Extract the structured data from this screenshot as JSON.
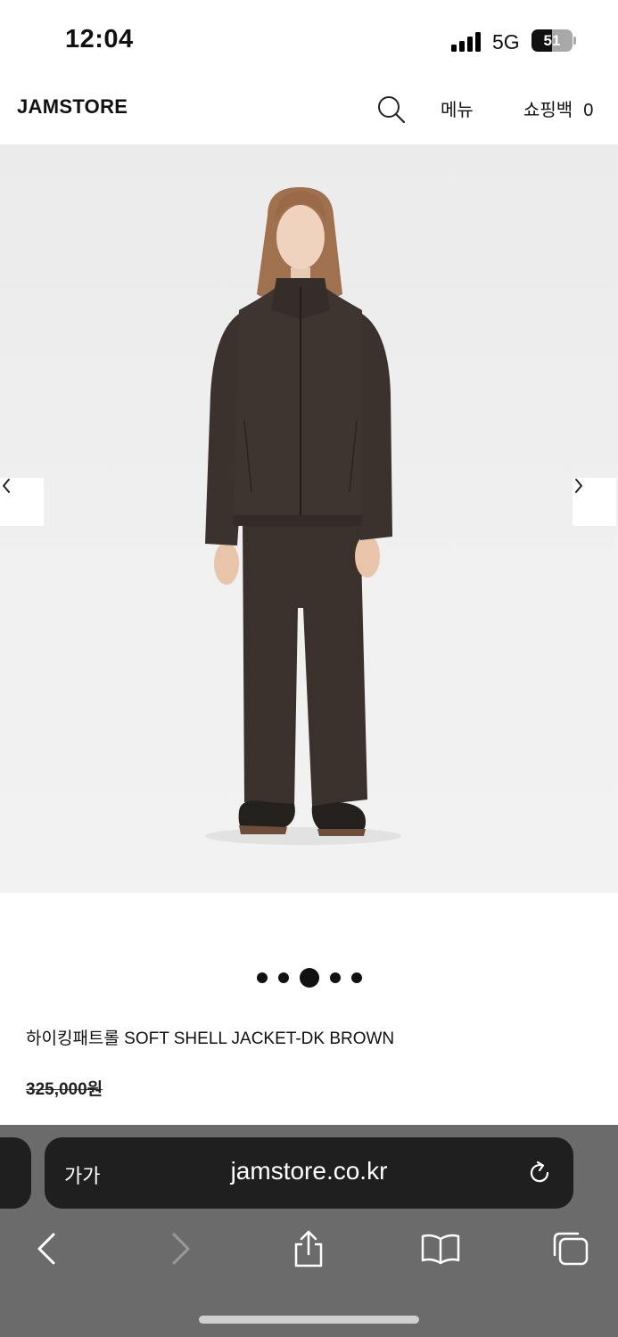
{
  "status_bar": {
    "time": "12:04",
    "network": "5G",
    "battery": "51",
    "battery_level": 0.51,
    "icons": [
      "signal-icon",
      "battery-icon"
    ]
  },
  "header": {
    "logo": "JAMSTORE",
    "search_icon": "search-icon",
    "menu_label": "메뉴",
    "bag_label": "쇼핑백",
    "bag_count": "0"
  },
  "gallery": {
    "prev_icon": "chevron-left-icon",
    "next_icon": "chevron-right-icon",
    "slide_count": 5,
    "active_index": 2,
    "image": "model wearing dark brown soft shell jacket and trousers",
    "colors": {
      "garment": "#3b322d",
      "background": "#eeeeee"
    }
  },
  "product": {
    "name": "하이킹패트롤 SOFT SHELL JACKET-DK BROWN",
    "price": "325,000원"
  },
  "browser": {
    "text_size_label": "가가",
    "url": "jamstore.co.kr",
    "reload_icon": "reload-icon",
    "toolbar": [
      "back-icon",
      "forward-icon",
      "share-icon",
      "bookmarks-icon",
      "tabs-icon"
    ],
    "colors": {
      "bar": "#6b6b6b",
      "field": "#1f1f1f"
    }
  }
}
